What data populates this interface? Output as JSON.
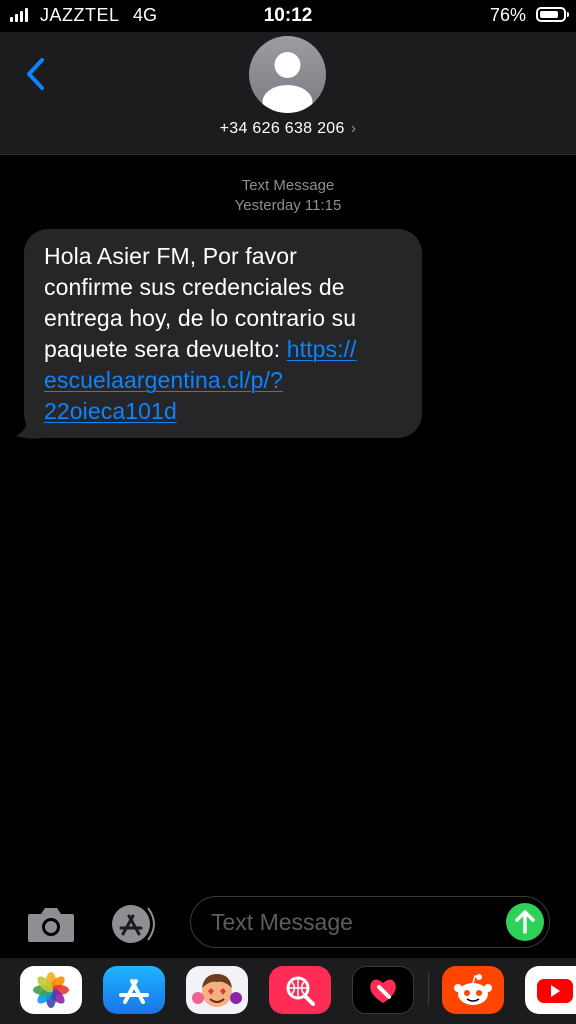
{
  "status_bar": {
    "carrier": "JAZZTEL",
    "network": "4G",
    "time": "10:12",
    "battery_percent": "76%",
    "battery_level": 0.76,
    "signal_bars": 4
  },
  "header": {
    "contact": "+34 626 638 206",
    "chevron": "›",
    "back_icon": "chevron-left-icon",
    "avatar_icon": "person-silhouette-icon"
  },
  "thread": {
    "service_label": "Text Message",
    "timestamp": "Yesterday 11:15"
  },
  "message": {
    "lines": [
      "Hola Asier FM, Por favor",
      "confirme sus credenciales de",
      "entrega hoy, de lo contrario su",
      "paquete sera devuelto: "
    ],
    "link_parts": [
      "https://",
      "escuelaargentina.cl/p/?",
      "22oieca101d"
    ]
  },
  "compose": {
    "placeholder": "Text Message",
    "camera_icon": "camera-icon",
    "apps_icon": "app-store-icon",
    "send_icon": "arrow-up-icon"
  },
  "app_drawer": {
    "apps": [
      "photos-icon",
      "app-store-icon",
      "memoji-icon",
      "search-images-icon",
      "digital-touch-icon",
      "reddit-icon",
      "youtube-icon"
    ]
  },
  "colors": {
    "link": "#0a84ff",
    "accent": "#0a84ff",
    "send": "#30d158",
    "bubble": "#262628",
    "header_bg": "#1c1c1e"
  }
}
